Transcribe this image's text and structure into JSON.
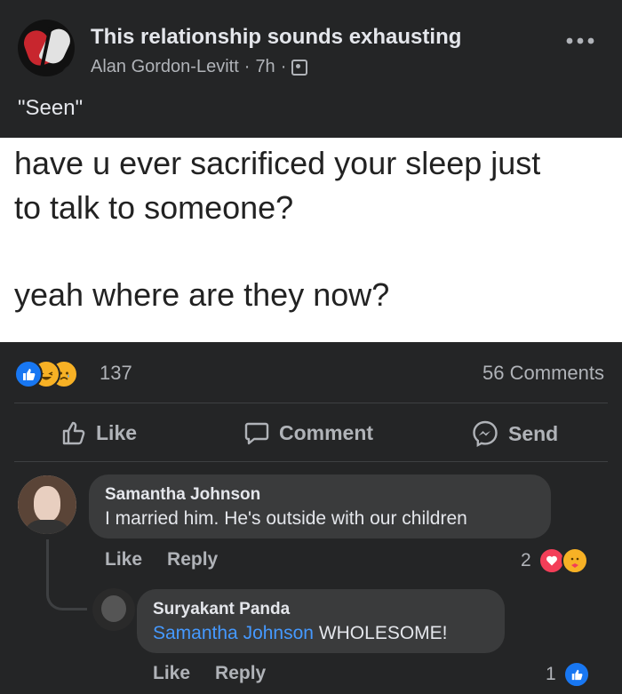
{
  "post": {
    "group_name": "This relationship sounds exhausting",
    "author": "Alan Gordon-Levitt",
    "time": "7h",
    "separator": "·",
    "caption": "\"Seen\"",
    "more_icon": "more-horizontal-icon"
  },
  "meme": {
    "line1": "have u ever sacrificed your sleep just",
    "line2": "to talk to someone?",
    "line3": "yeah where are they now?"
  },
  "stats": {
    "reaction_count": "137",
    "reaction_types": [
      "like",
      "haha",
      "sad"
    ],
    "comments": "56 Comments"
  },
  "actions": {
    "like": "Like",
    "comment": "Comment",
    "send": "Send"
  },
  "comments": [
    {
      "author": "Samantha Johnson",
      "text": "I married him. He's outside with our children",
      "like_label": "Like",
      "reply_label": "Reply",
      "reaction_count": "2",
      "reaction_types": [
        "love",
        "care"
      ]
    },
    {
      "author": "Suryakant Panda",
      "mention": "Samantha Johnson",
      "text": "WHOLESOME!",
      "like_label": "Like",
      "reply_label": "Reply",
      "reaction_count": "1",
      "reaction_types": [
        "like"
      ]
    }
  ],
  "colors": {
    "background": "#242526",
    "bubble": "#3a3b3c",
    "text": "#e4e6eb",
    "secondary_text": "#b0b3b8",
    "mention": "#4599ff",
    "like_blue": "#1877f2",
    "love_red": "#f33e58",
    "haha_yellow": "#f7b125"
  }
}
